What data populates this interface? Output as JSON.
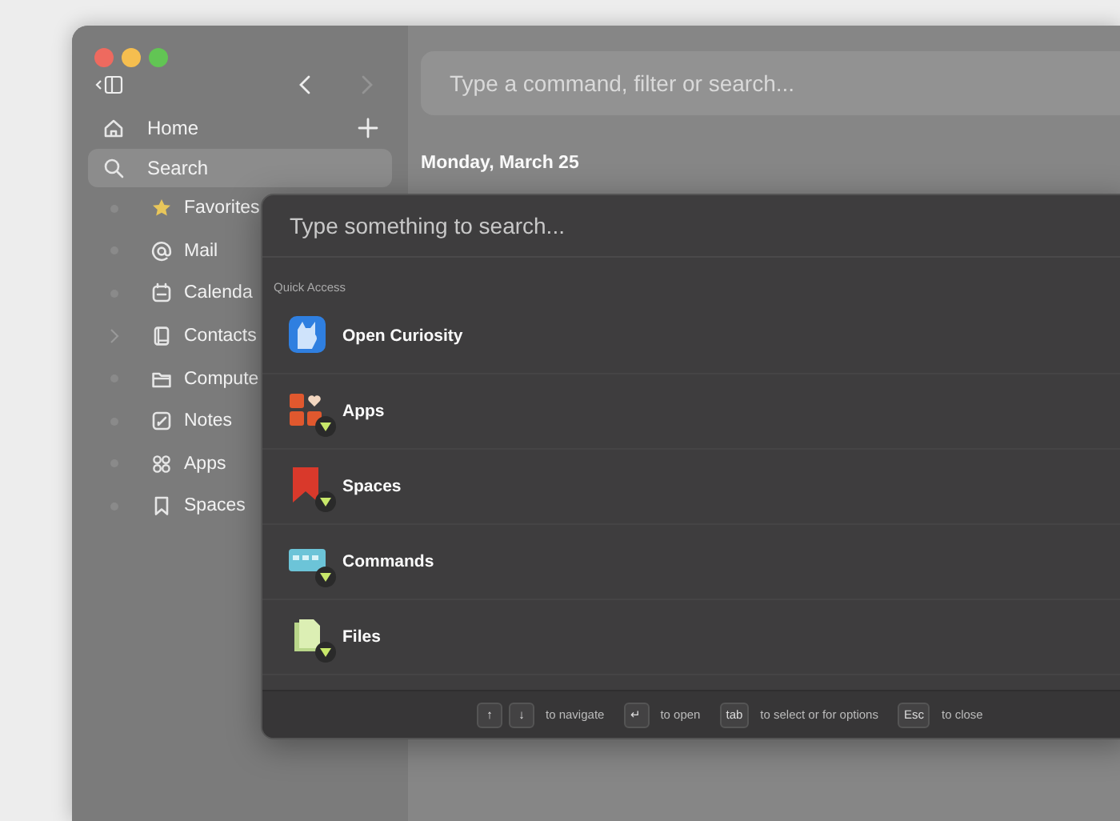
{
  "sidebar": {
    "nav": [
      {
        "label": "Home",
        "selected": false,
        "kind": "home"
      },
      {
        "label": "Search",
        "selected": true,
        "kind": "search"
      }
    ],
    "items": [
      {
        "label": "Favorites",
        "kind": "star",
        "expandable": false
      },
      {
        "label": "Mail",
        "kind": "at",
        "expandable": false
      },
      {
        "label": "Calenda",
        "kind": "calendar",
        "expandable": false
      },
      {
        "label": "Contacts",
        "kind": "book",
        "expandable": true
      },
      {
        "label": "Compute",
        "kind": "folder",
        "expandable": false
      },
      {
        "label": "Notes",
        "kind": "note",
        "expandable": false
      },
      {
        "label": "Apps",
        "kind": "grid",
        "expandable": false
      },
      {
        "label": "Spaces",
        "kind": "bookmark",
        "expandable": false
      }
    ]
  },
  "main": {
    "command_field": {
      "placeholder": "Type a command, filter or search..."
    },
    "date_heading": "Monday, March 25"
  },
  "search_dialog": {
    "search_field": {
      "placeholder": "Type something to search..."
    },
    "section_title": "Quick Access",
    "results": [
      {
        "label": "Open Curiosity",
        "kind": "app",
        "filter": false
      },
      {
        "label": "Apps",
        "kind": "apps",
        "filter": true
      },
      {
        "label": "Spaces",
        "kind": "spaces",
        "filter": true
      },
      {
        "label": "Commands",
        "kind": "commands",
        "filter": true
      },
      {
        "label": "Files",
        "kind": "files",
        "filter": true
      }
    ],
    "hints": [
      {
        "keys": [
          "↑",
          "↓"
        ],
        "text": "to navigate"
      },
      {
        "keys": [
          "↵"
        ],
        "text": "to open"
      },
      {
        "keys": [
          "tab"
        ],
        "text": "to select or for options"
      },
      {
        "keys": [
          "Esc"
        ],
        "text": "to close"
      }
    ]
  }
}
